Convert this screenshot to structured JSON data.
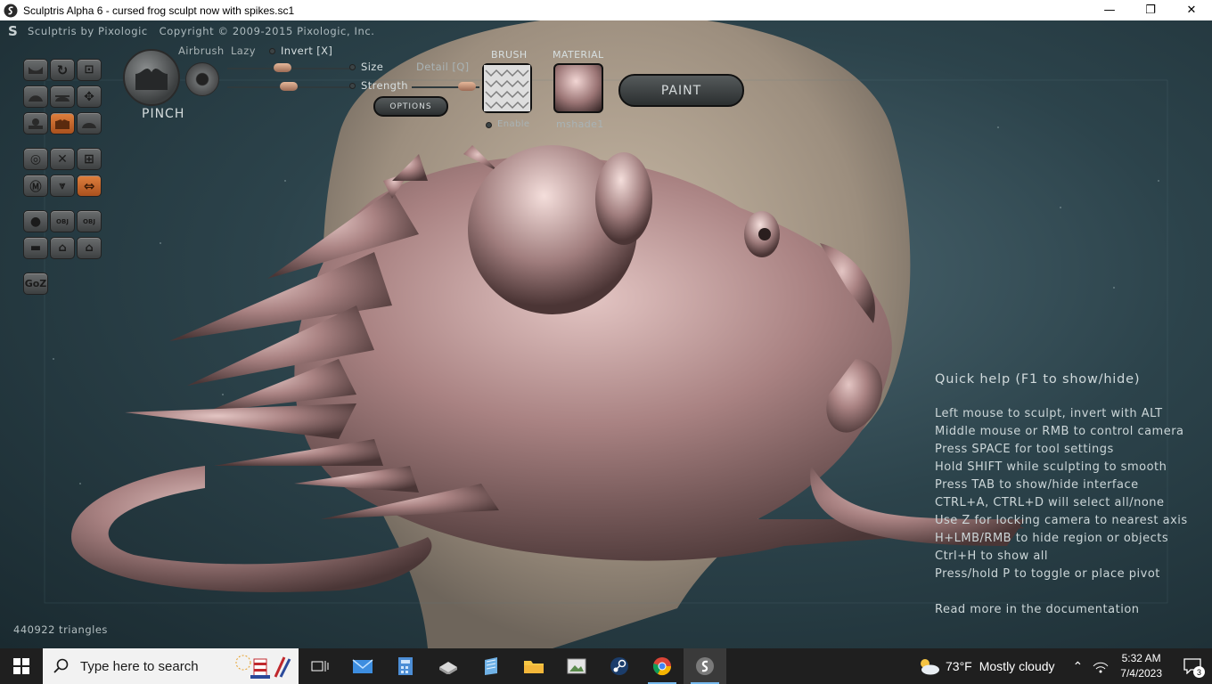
{
  "window": {
    "title": "Sculptris Alpha 6 - cursed frog sculpt now with spikes.sc1",
    "minimize": "—",
    "maximize": "❐",
    "close": "✕"
  },
  "header": {
    "logo": "S",
    "text": "Sculptris by Pixologic   Copyright © 2009-2015 Pixologic, Inc."
  },
  "tools": {
    "obj_label_1": "OBJ",
    "obj_label_2": "OBJ",
    "goz_label": "GoZ",
    "active_tools": [
      "pinch",
      "symmetry"
    ]
  },
  "brush_panel": {
    "current_tool": "PINCH",
    "airbrush": "Airbrush",
    "lazy": "Lazy",
    "invert": "Invert [X]",
    "size": "Size",
    "strength": "Strength",
    "detail": "Detail [Q]",
    "options": "OPTIONS",
    "size_level": 0.1,
    "strength_level": 0.1,
    "detail_level": 0.9
  },
  "brush_swatch": {
    "heading": "BRUSH",
    "enable": "Enable"
  },
  "material": {
    "heading": "MATERIAL",
    "name": "mshade1",
    "color": "#b58e8e"
  },
  "paint_button": "PAINT",
  "quick_help": {
    "title": "Quick help (F1 to show/hide)",
    "lines": [
      "Left mouse to sculpt, invert with ALT",
      "Middle mouse or RMB to control camera",
      "Press SPACE for tool settings",
      "Hold SHIFT while sculpting to smooth",
      "Press TAB to show/hide interface",
      "CTRL+A, CTRL+D will select all/none",
      "Use Z for locking camera to nearest axis",
      "H+LMB/RMB to hide region or objects",
      "Ctrl+H to show all",
      "Press/hold P to toggle or place pivot"
    ],
    "footer": "Read more in the documentation"
  },
  "status": {
    "triangles": "440922 triangles"
  },
  "taskbar": {
    "search_placeholder": "Type here to search",
    "weather_temp": "73°F",
    "weather_desc": "Mostly cloudy",
    "time": "5:32 AM",
    "date": "7/4/2023",
    "notification_count": "3",
    "accent": "#76b9ed"
  }
}
